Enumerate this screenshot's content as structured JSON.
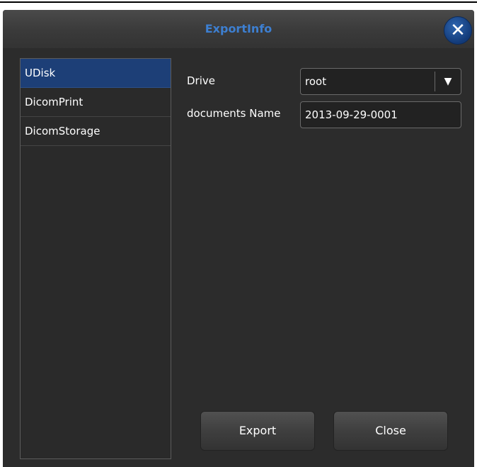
{
  "dialog": {
    "title": "ExportInfo",
    "close_icon": "close-icon"
  },
  "sidebar": {
    "items": [
      {
        "label": "UDisk",
        "selected": true
      },
      {
        "label": "DicomPrint",
        "selected": false
      },
      {
        "label": "DicomStorage",
        "selected": false
      }
    ]
  },
  "form": {
    "drive_label": "Drive",
    "drive_value": "root",
    "documents_label": "documents Name",
    "documents_value": "2013-09-29-0001"
  },
  "buttons": {
    "export_label": "Export",
    "close_label": "Close"
  },
  "colors": {
    "title": "#3d7fd1",
    "selected_item": "#1d3f77",
    "close_button": "#1a4a90",
    "background": "#2c2c2c"
  }
}
